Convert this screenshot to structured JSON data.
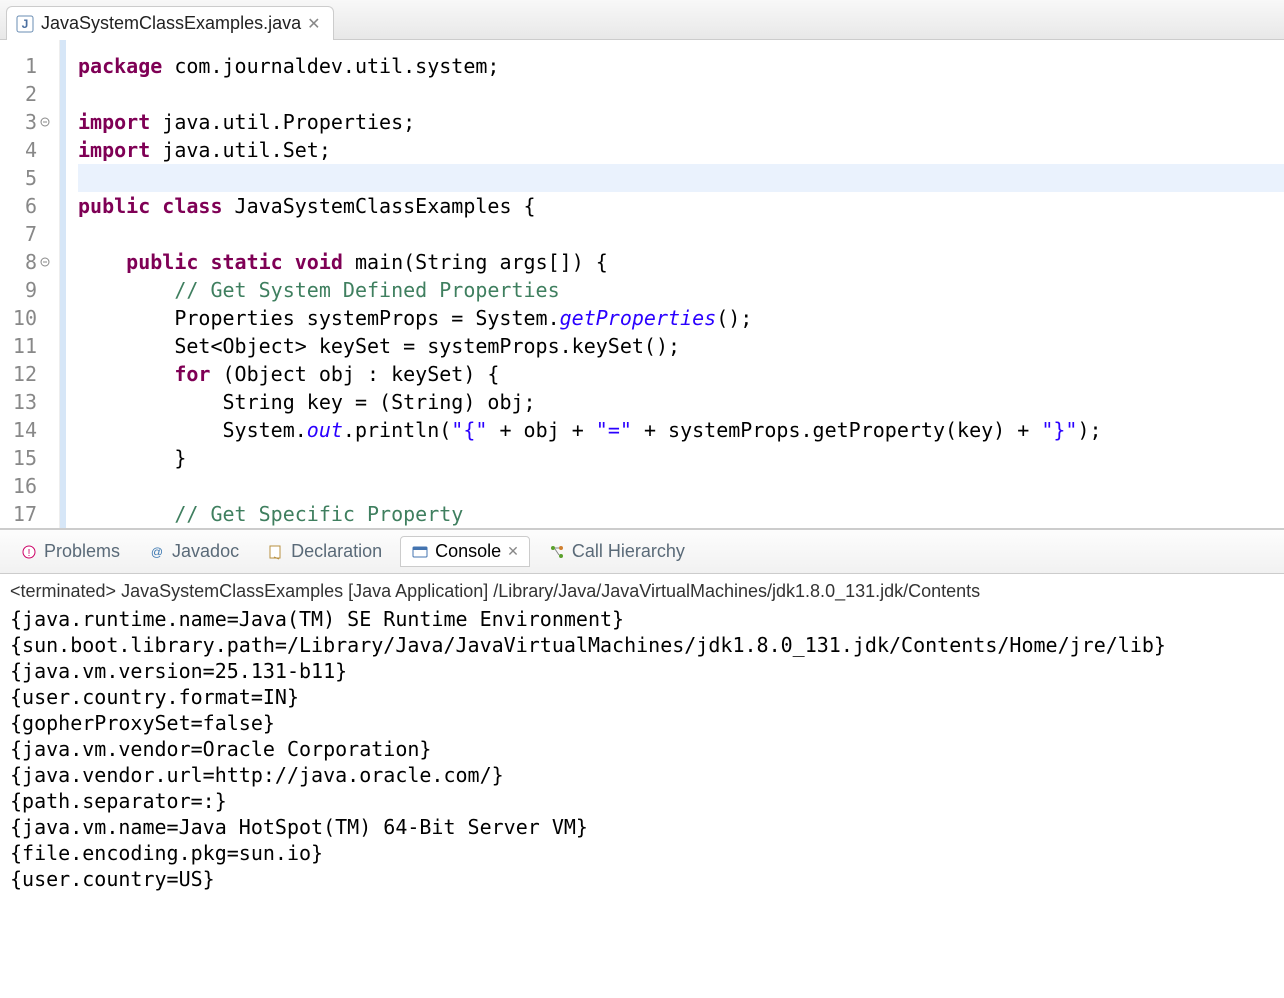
{
  "editor": {
    "tab_filename": "JavaSystemClassExamples.java",
    "lines": [
      {
        "n": 1,
        "fold": false,
        "hl": false,
        "html": "<span class='kw'>package</span> <span class='normal'>com.journaldev.util.system;</span>"
      },
      {
        "n": 2,
        "fold": false,
        "hl": false,
        "html": ""
      },
      {
        "n": 3,
        "fold": true,
        "hl": false,
        "html": "<span class='kw'>import</span> <span class='normal'>java.util.Properties;</span>"
      },
      {
        "n": 4,
        "fold": false,
        "hl": false,
        "html": "<span class='kw'>import</span> <span class='normal'>java.util.Set;</span>"
      },
      {
        "n": 5,
        "fold": false,
        "hl": true,
        "html": ""
      },
      {
        "n": 6,
        "fold": false,
        "hl": false,
        "html": "<span class='kw'>public class</span> <span class='type'>JavaSystemClassExamples</span> <span class='normal'>{</span>"
      },
      {
        "n": 7,
        "fold": false,
        "hl": false,
        "html": ""
      },
      {
        "n": 8,
        "fold": true,
        "hl": false,
        "html": "    <span class='kw'>public static void</span> <span class='normal'>main(String args[]) {</span>"
      },
      {
        "n": 9,
        "fold": false,
        "hl": false,
        "html": "        <span class='comment'>// Get System Defined Properties</span>"
      },
      {
        "n": 10,
        "fold": false,
        "hl": false,
        "html": "        <span class='normal'>Properties systemProps = System.</span><span class='static-italic'>getProperties</span><span class='normal'>();</span>"
      },
      {
        "n": 11,
        "fold": false,
        "hl": false,
        "html": "        <span class='normal'>Set&lt;Object&gt; keySet = systemProps.keySet();</span>"
      },
      {
        "n": 12,
        "fold": false,
        "hl": false,
        "html": "        <span class='kw'>for</span> <span class='normal'>(Object obj : keySet) {</span>"
      },
      {
        "n": 13,
        "fold": false,
        "hl": false,
        "html": "            <span class='normal'>String key = (String) obj;</span>"
      },
      {
        "n": 14,
        "fold": false,
        "hl": false,
        "html": "            <span class='normal'>System.</span><span class='static-italic'>out</span><span class='normal'>.println(</span><span class='str'>\"{\"</span><span class='normal'> + obj + </span><span class='str'>\"=\"</span><span class='normal'> + systemProps.getProperty(key) + </span><span class='str'>\"}\"</span><span class='normal'>);</span>"
      },
      {
        "n": 15,
        "fold": false,
        "hl": false,
        "html": "        <span class='normal'>}</span>"
      },
      {
        "n": 16,
        "fold": false,
        "hl": false,
        "html": ""
      },
      {
        "n": 17,
        "fold": false,
        "hl": false,
        "html": "        <span class='comment'>// Get Specific Property</span>"
      }
    ]
  },
  "views": {
    "problems": "Problems",
    "javadoc": "Javadoc",
    "declaration": "Declaration",
    "console": "Console",
    "call_hierarchy": "Call Hierarchy"
  },
  "console": {
    "header": "<terminated> JavaSystemClassExamples [Java Application] /Library/Java/JavaVirtualMachines/jdk1.8.0_131.jdk/Contents",
    "lines": [
      "{java.runtime.name=Java(TM) SE Runtime Environment}",
      "{sun.boot.library.path=/Library/Java/JavaVirtualMachines/jdk1.8.0_131.jdk/Contents/Home/jre/lib}",
      "{java.vm.version=25.131-b11}",
      "{user.country.format=IN}",
      "{gopherProxySet=false}",
      "{java.vm.vendor=Oracle Corporation}",
      "{java.vendor.url=http://java.oracle.com/}",
      "{path.separator=:}",
      "{java.vm.name=Java HotSpot(TM) 64-Bit Server VM}",
      "{file.encoding.pkg=sun.io}",
      "{user.country=US}"
    ]
  }
}
